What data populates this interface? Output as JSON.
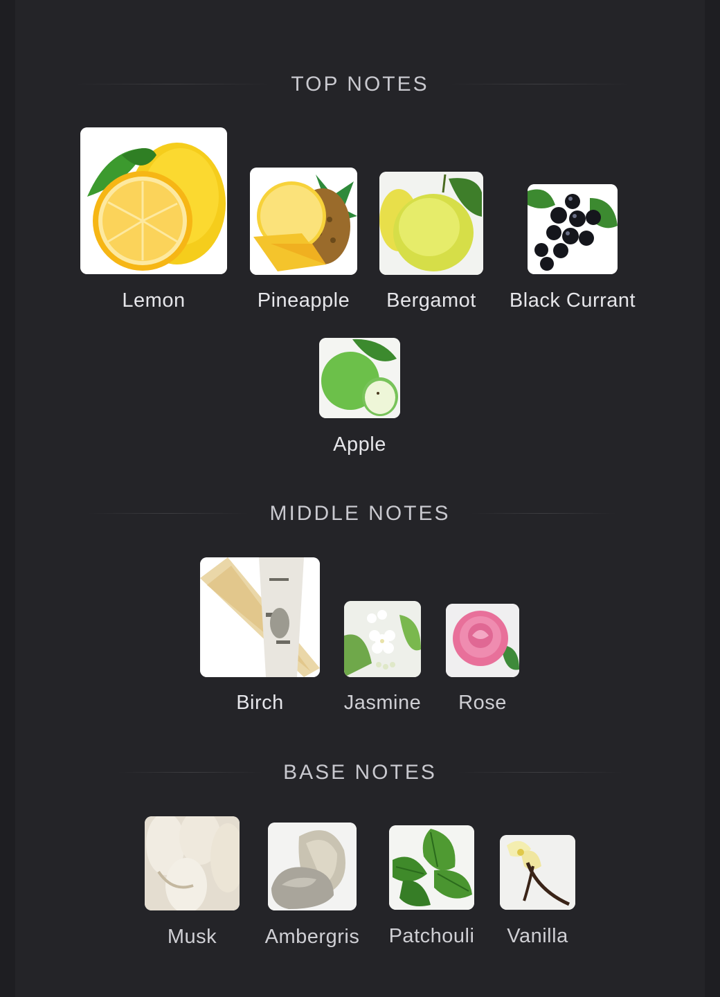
{
  "sections": [
    {
      "title": "TOP NOTES",
      "notes": [
        {
          "label": "Lemon",
          "icon": "lemon-icon"
        },
        {
          "label": "Pineapple",
          "icon": "pineapple-icon"
        },
        {
          "label": "Bergamot",
          "icon": "bergamot-icon"
        },
        {
          "label": "Black Currant",
          "icon": "black-currant-icon"
        },
        {
          "label": "Apple",
          "icon": "apple-icon"
        }
      ]
    },
    {
      "title": "MIDDLE NOTES",
      "notes": [
        {
          "label": "Birch",
          "icon": "birch-icon"
        },
        {
          "label": "Jasmine",
          "icon": "jasmine-icon"
        },
        {
          "label": "Rose",
          "icon": "rose-icon"
        }
      ]
    },
    {
      "title": "BASE NOTES",
      "notes": [
        {
          "label": "Musk",
          "icon": "musk-icon"
        },
        {
          "label": "Ambergris",
          "icon": "ambergris-icon"
        },
        {
          "label": "Patchouli",
          "icon": "patchouli-icon"
        },
        {
          "label": "Vanilla",
          "icon": "vanilla-icon"
        }
      ]
    }
  ]
}
